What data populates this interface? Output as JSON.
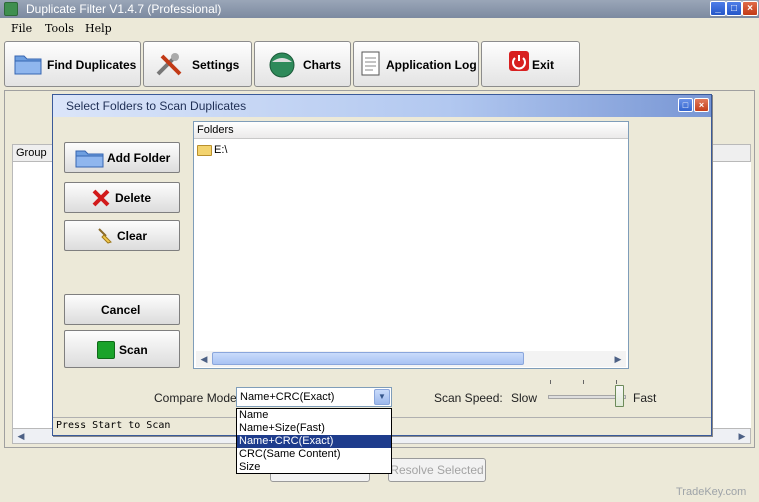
{
  "window": {
    "title": "Duplicate Filter V1.4.7 (Professional)",
    "controls": [
      "_",
      "□",
      "×"
    ]
  },
  "menu": [
    "File",
    "Tools",
    "Help"
  ],
  "toolbar": {
    "find_duplicates": "Find Duplicates",
    "settings": "Settings",
    "charts": "Charts",
    "application_log": "Application Log",
    "exit": "Exit"
  },
  "background": {
    "group_header": "Group",
    "resolve_selected": "Resolve Selected"
  },
  "dialog": {
    "title": "Select Folders to Scan Duplicates",
    "buttons": {
      "add_folder": "Add Folder",
      "delete": "Delete",
      "clear": "Clear",
      "cancel": "Cancel",
      "scan": "Scan"
    },
    "folders_header": "Folders",
    "folders": [
      "E:\\"
    ],
    "compare_mode_label": "Compare Mode:",
    "compare_mode_value": "Name+CRC(Exact)",
    "compare_mode_options": [
      "Name",
      "Name+Size(Fast)",
      "Name+CRC(Exact)",
      "CRC(Same Content)",
      "Size"
    ],
    "scan_speed_label": "Scan Speed:",
    "speed_slow": "Slow",
    "speed_fast": "Fast",
    "speed_level": 1.0,
    "status": "Press Start to Scan"
  },
  "watermark": "TradeKey.com",
  "colors": {
    "dialog_title_gradient_end": "#7896d4",
    "selected_option": "#1e3c8c",
    "exit_icon": "#d82020",
    "scan_icon": "#1aa32a"
  }
}
